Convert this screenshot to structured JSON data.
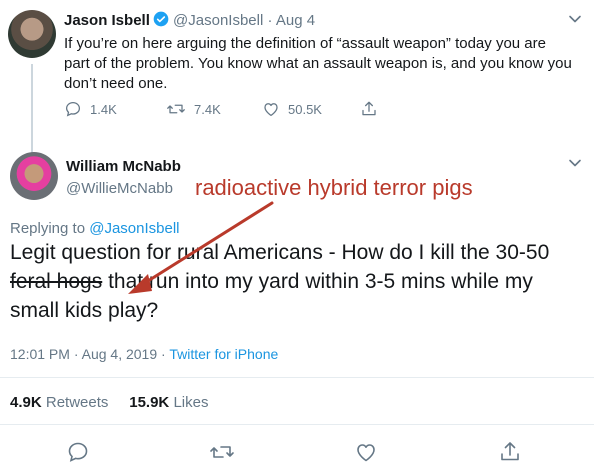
{
  "tweet1": {
    "name": "Jason Isbell",
    "handle": "@JasonIsbell",
    "sep": " · ",
    "date": "Aug 4",
    "text": "If you’re on here arguing the definition of “assault weapon” today you are part of the problem. You know what an assault weapon is, and you know you don’t need one.",
    "replies": "1.4K",
    "retweets": "7.4K",
    "likes": "50.5K"
  },
  "tweet2": {
    "name": "William McNabb",
    "handle": "@WillieMcNabb",
    "replying_label": "Replying to",
    "replying_handle": "@JasonIsbell",
    "text_before": "Legit question for rural Americans - How do I kill the 30-50 ",
    "text_struck": "feral hogs",
    "text_after": " that run into my yard within 3-5 mins while my small kids play?",
    "time": "12:01 PM",
    "sep1": " · ",
    "date": "Aug 4, 2019",
    "sep2": " · ",
    "source": "Twitter for iPhone",
    "retweets_count": "4.9K",
    "retweets_label": "Retweets",
    "likes_count": "15.9K",
    "likes_label": "Likes"
  },
  "annotation": "radioactive hybrid terror pigs",
  "colors": {
    "accent": "#1b95e0",
    "muted": "#657786",
    "annotation": "#b93a2b",
    "verified": "#1da1f2"
  },
  "icons": [
    "verified-icon",
    "chevron-down-icon",
    "reply-icon",
    "retweet-icon",
    "like-icon",
    "share-icon"
  ]
}
